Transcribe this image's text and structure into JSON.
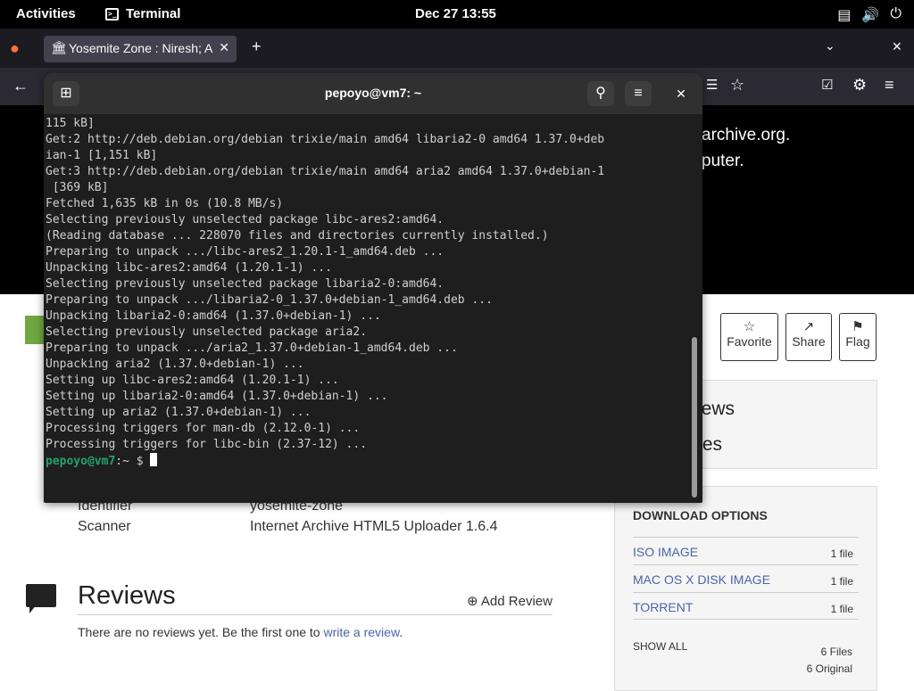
{
  "topbar": {
    "activities": "Activities",
    "app_name": "Terminal",
    "clock": "Dec 27  13:55"
  },
  "browser": {
    "tab_title": "Yosemite Zone : Niresh; A",
    "new_tab": "+"
  },
  "page": {
    "hero_line1": "archive.org.",
    "hero_line2": "puter.",
    "actions": {
      "favorite": "Favorite",
      "share": "Share",
      "flag": "Flag"
    },
    "side_links": {
      "reviews": "iews",
      "notes": "tes"
    },
    "metadata": [
      {
        "key": "Identifier",
        "value": "yosemite-zone"
      },
      {
        "key": "Scanner",
        "value": "Internet Archive HTML5 Uploader 1.6.4"
      }
    ],
    "reviews": {
      "title": "Reviews",
      "add_review": "Add Review",
      "empty_prefix": "There are no reviews yet. Be the first one to ",
      "empty_link": "write a review",
      "empty_suffix": "."
    },
    "downloads": {
      "header": "DOWNLOAD OPTIONS",
      "items": [
        {
          "name": "ISO IMAGE",
          "count": "1 file"
        },
        {
          "name": "MAC OS X DISK IMAGE",
          "count": "1 file"
        },
        {
          "name": "TORRENT",
          "count": "1 file"
        }
      ],
      "show_all": "SHOW ALL",
      "files": "6 Files",
      "original": "6 Original"
    }
  },
  "terminal": {
    "title": "pepoyo@vm7: ~",
    "lines": [
      "115 kB]",
      "Get:2 http://deb.debian.org/debian trixie/main amd64 libaria2-0 amd64 1.37.0+deb",
      "ian-1 [1,151 kB]",
      "Get:3 http://deb.debian.org/debian trixie/main amd64 aria2 amd64 1.37.0+debian-1",
      " [369 kB]",
      "Fetched 1,635 kB in 0s (10.8 MB/s)",
      "Selecting previously unselected package libc-ares2:amd64.",
      "(Reading database ... 228070 files and directories currently installed.)",
      "Preparing to unpack .../libc-ares2_1.20.1-1_amd64.deb ...",
      "Unpacking libc-ares2:amd64 (1.20.1-1) ...",
      "Selecting previously unselected package libaria2-0:amd64.",
      "Preparing to unpack .../libaria2-0_1.37.0+debian-1_amd64.deb ...",
      "Unpacking libaria2-0:amd64 (1.37.0+debian-1) ...",
      "Selecting previously unselected package aria2.",
      "Preparing to unpack .../aria2_1.37.0+debian-1_amd64.deb ...",
      "Unpacking aria2 (1.37.0+debian-1) ...",
      "Setting up libc-ares2:amd64 (1.20.1-1) ...",
      "Setting up libaria2-0:amd64 (1.37.0+debian-1) ...",
      "Setting up aria2 (1.37.0+debian-1) ...",
      "Processing triggers for man-db (2.12.0-1) ...",
      "Processing triggers for libc-bin (2.37-12) ..."
    ],
    "prompt_user": "pepoyo@vm7",
    "prompt_rest": ":~ $ "
  },
  "colors": {
    "prompt": "#26a269",
    "link": "#4b64a8",
    "terminal_bg": "#1e1e1e"
  }
}
